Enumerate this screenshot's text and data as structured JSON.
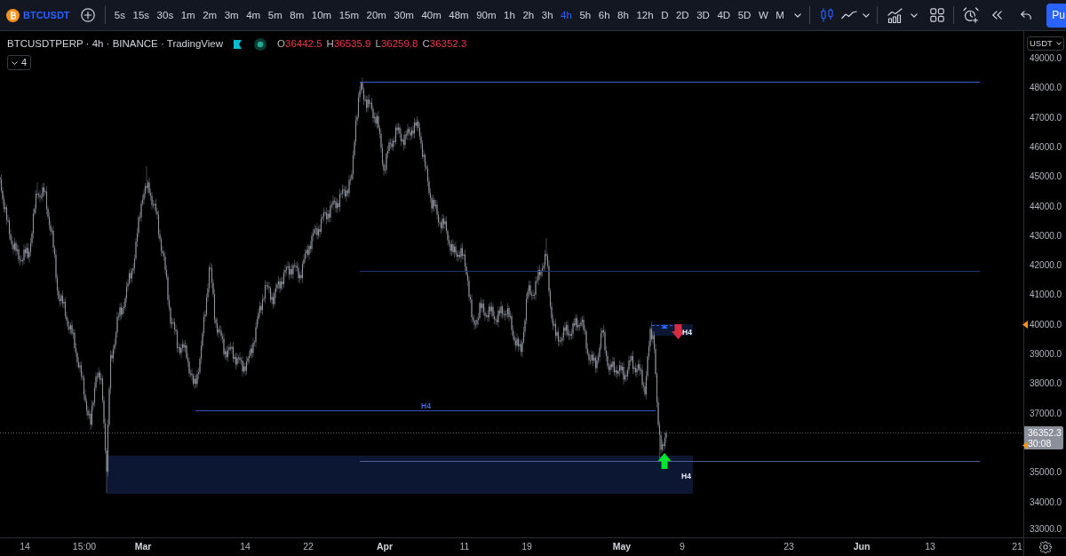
{
  "toolbar": {
    "symbol": "BTCUSDT",
    "intervals": [
      {
        "label": "5s",
        "selected": false
      },
      {
        "label": "15s",
        "selected": false
      },
      {
        "label": "30s",
        "selected": false
      },
      {
        "label": "1m",
        "selected": false
      },
      {
        "label": "2m",
        "selected": false
      },
      {
        "label": "3m",
        "selected": false
      },
      {
        "label": "4m",
        "selected": false
      },
      {
        "label": "5m",
        "selected": false
      },
      {
        "label": "8m",
        "selected": false
      },
      {
        "label": "10m",
        "selected": false
      },
      {
        "label": "15m",
        "selected": false
      },
      {
        "label": "20m",
        "selected": false
      },
      {
        "label": "30m",
        "selected": false
      },
      {
        "label": "40m",
        "selected": false
      },
      {
        "label": "48m",
        "selected": false
      },
      {
        "label": "90m",
        "selected": false
      },
      {
        "label": "1h",
        "selected": false
      },
      {
        "label": "2h",
        "selected": false
      },
      {
        "label": "3h",
        "selected": false
      },
      {
        "label": "4h",
        "selected": true
      },
      {
        "label": "5h",
        "selected": false
      },
      {
        "label": "6h",
        "selected": false
      },
      {
        "label": "8h",
        "selected": false
      },
      {
        "label": "12h",
        "selected": false
      },
      {
        "label": "D",
        "selected": false
      },
      {
        "label": "2D",
        "selected": false
      },
      {
        "label": "3D",
        "selected": false
      },
      {
        "label": "4D",
        "selected": false
      },
      {
        "label": "5D",
        "selected": false
      },
      {
        "label": "W",
        "selected": false
      },
      {
        "label": "M",
        "selected": false
      }
    ],
    "publish_button": "Pu"
  },
  "legend": {
    "title": "BTCUSDTPERP · 4h · BINANCE · TradingView",
    "ohlc": [
      {
        "key": "O",
        "value": "36442.5"
      },
      {
        "key": "H",
        "value": "36535.9"
      },
      {
        "key": "L",
        "value": "36259.8"
      },
      {
        "key": "C",
        "value": "36352.3"
      }
    ],
    "indicator_count": "4"
  },
  "price_axis": {
    "currency": "USDT",
    "labels": [
      "49000.0",
      "48000.0",
      "47000.0",
      "46000.0",
      "45000.0",
      "44000.0",
      "43000.0",
      "42000.0",
      "41000.0",
      "40000.0",
      "39000.0",
      "38000.0",
      "37000.0",
      "35000.0",
      "34000.0",
      "33000.0"
    ],
    "last_price": "36352.3",
    "countdown": "30:08"
  },
  "time_axis": {
    "labels": [
      {
        "label": "14",
        "kind": "day"
      },
      {
        "label": "15:00",
        "kind": "time"
      },
      {
        "label": "Mar",
        "kind": "month"
      },
      {
        "label": "14",
        "kind": "day"
      },
      {
        "label": "22",
        "kind": "day"
      },
      {
        "label": "Apr",
        "kind": "month"
      },
      {
        "label": "11",
        "kind": "day"
      },
      {
        "label": "19",
        "kind": "day"
      },
      {
        "label": "May",
        "kind": "month"
      },
      {
        "label": "9",
        "kind": "day"
      },
      {
        "label": "23",
        "kind": "day"
      },
      {
        "label": "Jun",
        "kind": "month"
      },
      {
        "label": "13",
        "kind": "day"
      },
      {
        "label": "21",
        "kind": "day"
      }
    ]
  },
  "drawing_labels": [
    "H4",
    "H4",
    "H4"
  ]
}
